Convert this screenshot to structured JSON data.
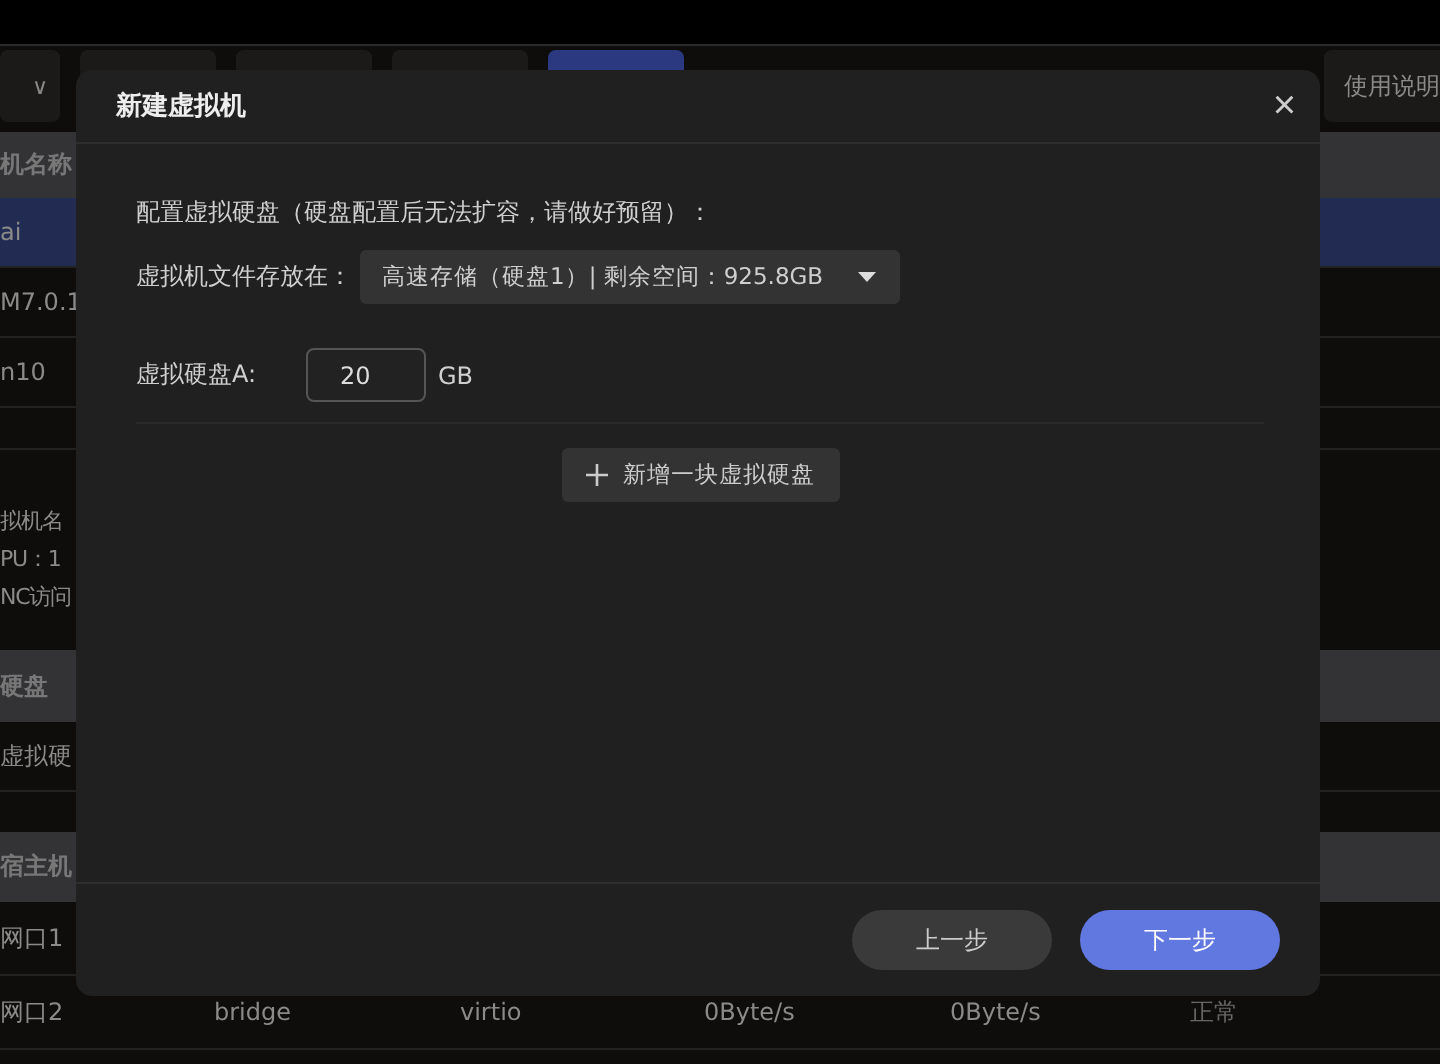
{
  "toolbar": {
    "first_caret": "∨",
    "buttons": [
      {
        "selected": false
      },
      {
        "selected": false
      },
      {
        "selected": false
      },
      {
        "selected": false
      },
      {
        "selected": true
      }
    ],
    "help": "使用说明"
  },
  "vm_table": {
    "header": "机名称",
    "rows": [
      {
        "name": "ai",
        "selected": true
      },
      {
        "name": "M7.0.1",
        "selected": false
      },
      {
        "name": "n10",
        "selected": false
      }
    ]
  },
  "details": [
    "拟机名",
    "PU：1",
    "NC访问"
  ],
  "disk_table": {
    "header": "硬盘",
    "rows": [
      "虚拟硬"
    ]
  },
  "host_table": {
    "header": "宿主机",
    "rows": [
      {
        "cells": [
          "网口1"
        ]
      },
      {
        "cells": [
          "网口2",
          "bridge",
          "virtio",
          "0Byte/s",
          "0Byte/s",
          "正常"
        ]
      }
    ]
  },
  "dialog": {
    "title": "新建虚拟机",
    "close": "×",
    "intro": "配置虚拟硬盘（硬盘配置后无法扩容，请做好预留）：",
    "location_label": "虚拟机文件存放在：",
    "location_value": "高速存储（硬盘1）| 剩余空间：925.8GB",
    "disks": [
      {
        "label": "虚拟硬盘A:",
        "value": "20",
        "unit": "GB"
      }
    ],
    "add_disk": "新增一块虚拟硬盘",
    "buttons": [
      {
        "label": "上一步",
        "kind": "secondary"
      },
      {
        "label": "下一步",
        "kind": "primary"
      }
    ]
  }
}
